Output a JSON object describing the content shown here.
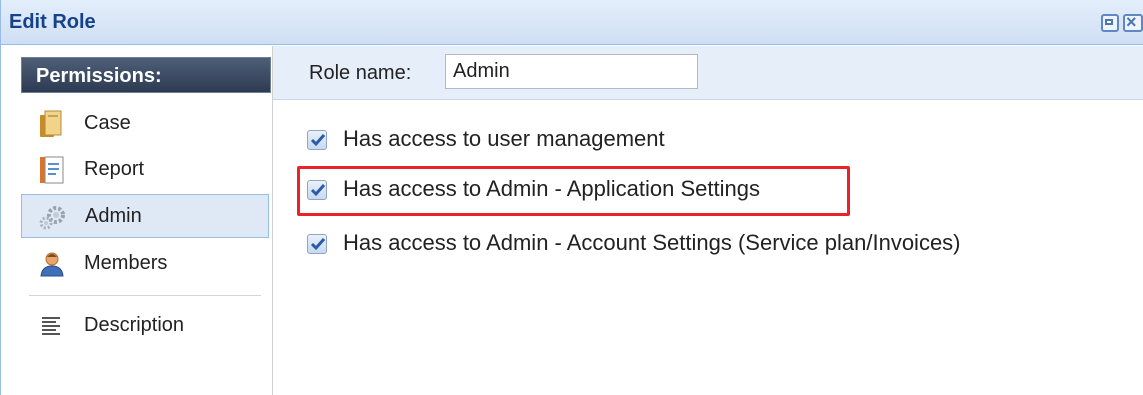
{
  "window": {
    "title": "Edit Role"
  },
  "sidebar": {
    "header": "Permissions:",
    "items": [
      {
        "label": "Case",
        "icon": "case-icon"
      },
      {
        "label": "Report",
        "icon": "report-icon"
      },
      {
        "label": "Admin",
        "icon": "gear-icon",
        "selected": true
      },
      {
        "label": "Members",
        "icon": "user-icon"
      },
      {
        "label": "Description",
        "icon": "description-icon"
      }
    ]
  },
  "form": {
    "role_name_label": "Role name:",
    "role_name_value": "Admin"
  },
  "permissions": [
    {
      "label": "Has access to user management",
      "checked": true
    },
    {
      "label": "Has access to Admin - Application Settings",
      "checked": true,
      "highlighted": true
    },
    {
      "label": "Has access to Admin - Account Settings (Service plan/Invoices)",
      "checked": true
    }
  ],
  "colors": {
    "title_text": "#15428b",
    "highlight": "#e8232a",
    "selected_bg": "#dfe9f6"
  }
}
